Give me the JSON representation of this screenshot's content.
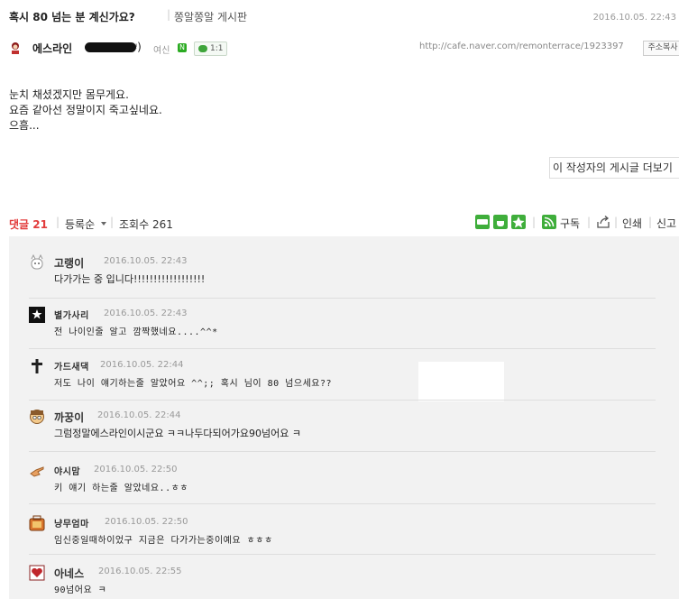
{
  "post": {
    "title": "혹시 80 넘는 분 계신가요?",
    "board": "쫑알쫑알 게시판",
    "date": "2016.10.05. 22:43",
    "author": {
      "name_prefix": "에스라인",
      "name_suffix": "ᵎ)",
      "gender": "여신",
      "grade_badge": "N",
      "chat_label": "1:1"
    },
    "url": "http://cafe.naver.com/remonterrace/1923397",
    "copy_label": "주소복사",
    "body_lines": [
      "눈치 채셨겠지만 몸무게요.",
      "요즘 같아선 정말이지 죽고싶네요.",
      "으흠..."
    ],
    "more_posts_label": "이 작성자의 게시글 더보기"
  },
  "comment_bar": {
    "comments_label": "댓글",
    "comments_count": "21",
    "sort_label": "등록순",
    "views_label": "조회수",
    "views_count": "261",
    "subscribe_label": "구독",
    "print_label": "인쇄",
    "report_label": "신고"
  },
  "comments": [
    {
      "nick": "고랭이",
      "date": "2016.10.05. 22:43",
      "text": "다가가는 중 입니다!!!!!!!!!!!!!!!!!!",
      "avatar": "cat-icon"
    },
    {
      "nick": "별가사리",
      "date": "2016.10.05. 22:43",
      "text": "전 나이인줄 알고 깜짝했네요....^^*",
      "avatar": "star-icon"
    },
    {
      "nick": "가드새댁",
      "date": "2016.10.05. 22:44",
      "text": "저도 나이 얘기하는줄 알았어요 ^^;; 혹시 님이 80 넘으세요??",
      "avatar": "cross-icon"
    },
    {
      "nick": "까꿍이",
      "date": "2016.10.05. 22:44",
      "text": "그럼정말에스라인이시군요 ㅋㅋ나두다되어가요90넘어요 ㅋ",
      "avatar": "face-icon"
    },
    {
      "nick": "야시맘",
      "date": "2016.10.05. 22:50",
      "text": "키 얘기 하는줄 알았네요..ㅎㅎ",
      "avatar": "hand-icon"
    },
    {
      "nick": "냥무엄마",
      "date": "2016.10.05. 22:50",
      "text": "임신중일때하이었구 지금은 다가가는중이예요 ㅎㅎㅎ",
      "avatar": "bag-icon"
    },
    {
      "nick": "아네스",
      "date": "2016.10.05. 22:55",
      "text": "90넘어요 ㅋ",
      "avatar": "heart-icon"
    }
  ],
  "colors": {
    "accent_red": "#e23b3b",
    "naver_green": "#2bab22",
    "comment_bg": "#f2f2f2"
  }
}
